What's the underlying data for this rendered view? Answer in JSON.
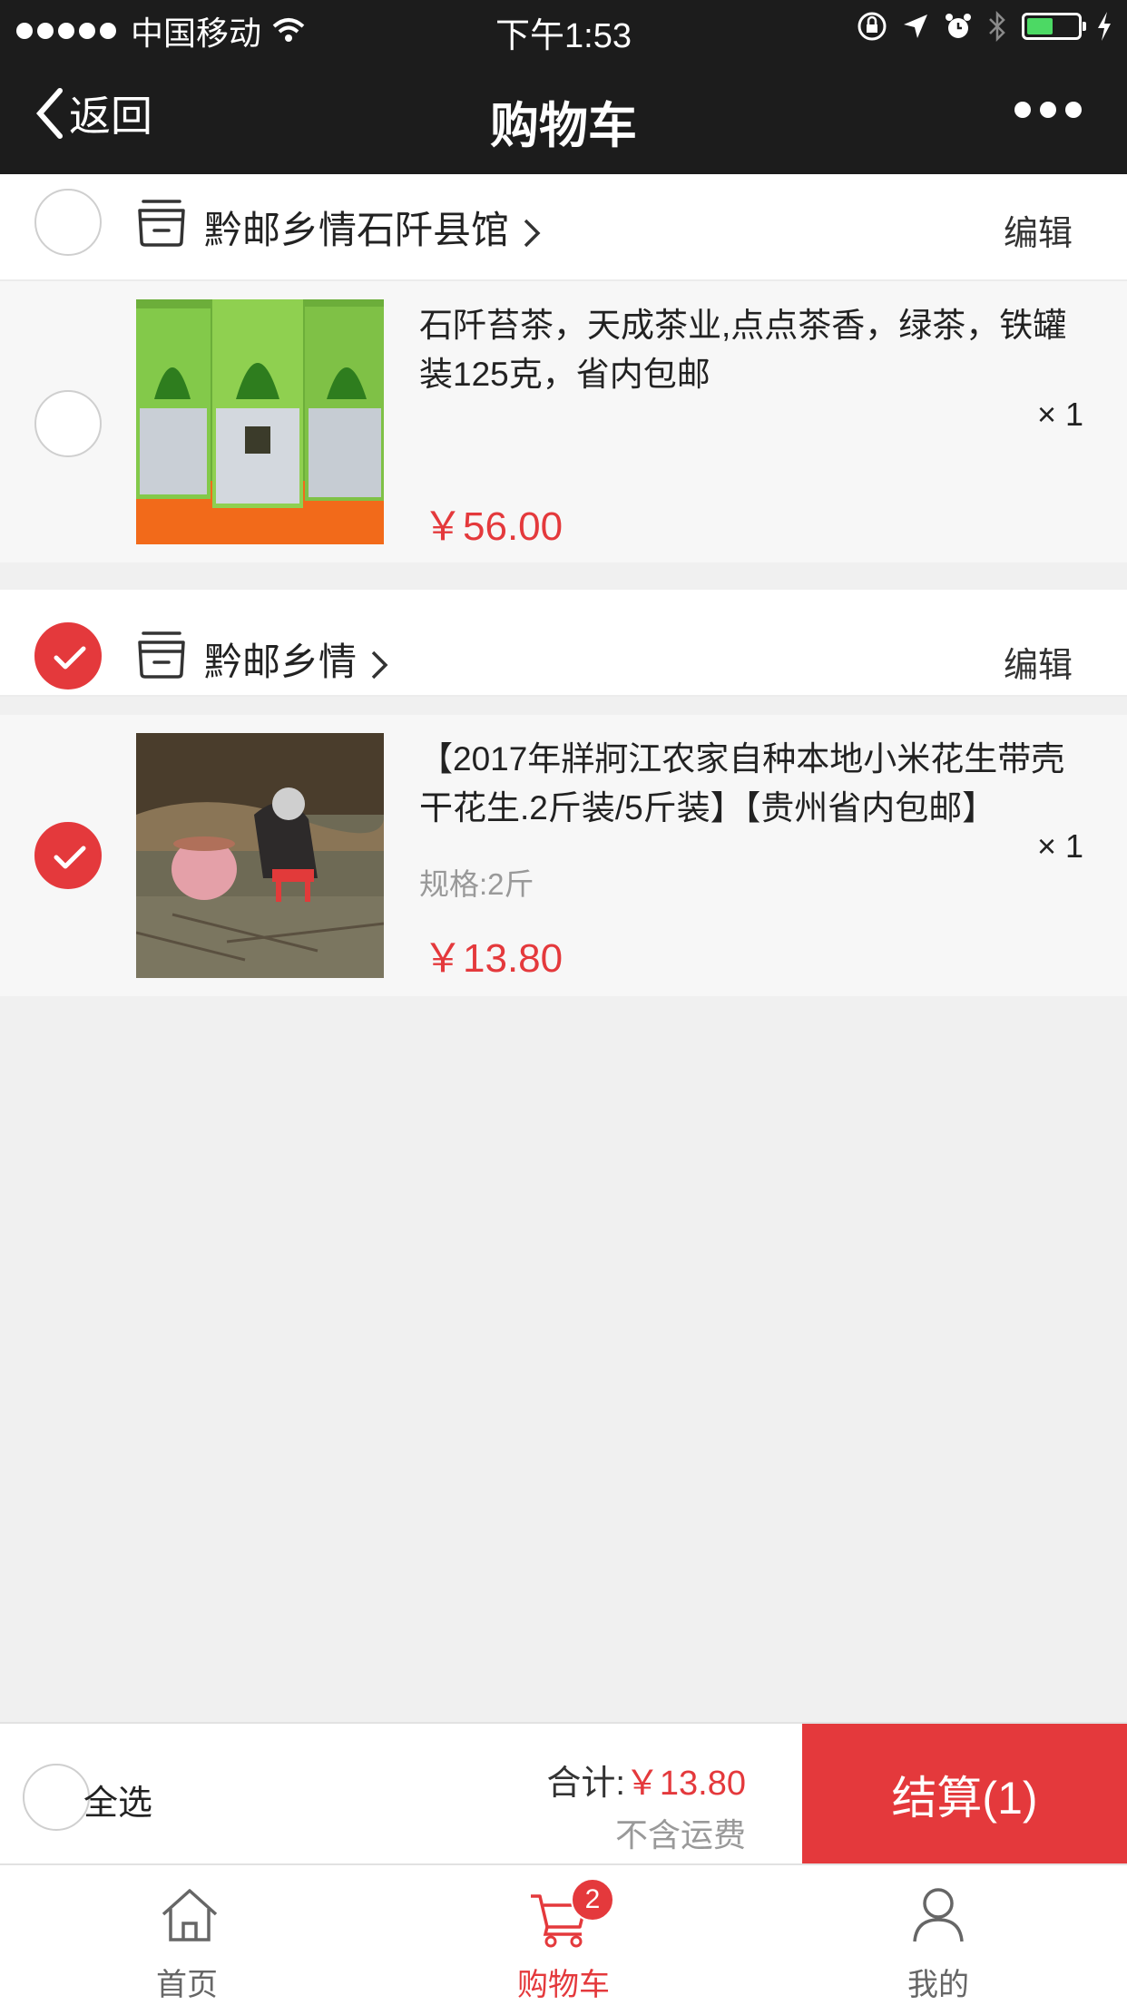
{
  "status_bar": {
    "carrier": "中国移动",
    "time": "下午1:53"
  },
  "nav": {
    "back_label": "返回",
    "title": "购物车"
  },
  "shops": [
    {
      "name": "黔邮乡情石阡县馆",
      "edit_label": "编辑",
      "checked": false,
      "items": [
        {
          "name": "石阡苔茶，天成茶业,点点茶香，绿茶，铁罐装125克，省内包邮",
          "spec": "",
          "price": "￥56.00",
          "qty": "× 1",
          "checked": false
        }
      ]
    },
    {
      "name": "黔邮乡情",
      "edit_label": "编辑",
      "checked": true,
      "items": [
        {
          "name": "【2017年牂牁江农家自种本地小米花生带壳干花生.2斤装/5斤装】【贵州省内包邮】",
          "spec": "规格:2斤",
          "price": "￥13.80",
          "qty": "× 1",
          "checked": true
        }
      ]
    }
  ],
  "checkout": {
    "select_all_label": "全选",
    "total_label": "合计:",
    "total_amount": "￥13.80",
    "shipping_note": "不含运费",
    "pay_button": "结算(1)"
  },
  "tabbar": {
    "home": "首页",
    "cart": "购物车",
    "cart_badge": "2",
    "mine": "我的"
  },
  "colors": {
    "accent": "#e4393c",
    "topbar": "#1c1c1c",
    "battery": "#4cd964"
  }
}
